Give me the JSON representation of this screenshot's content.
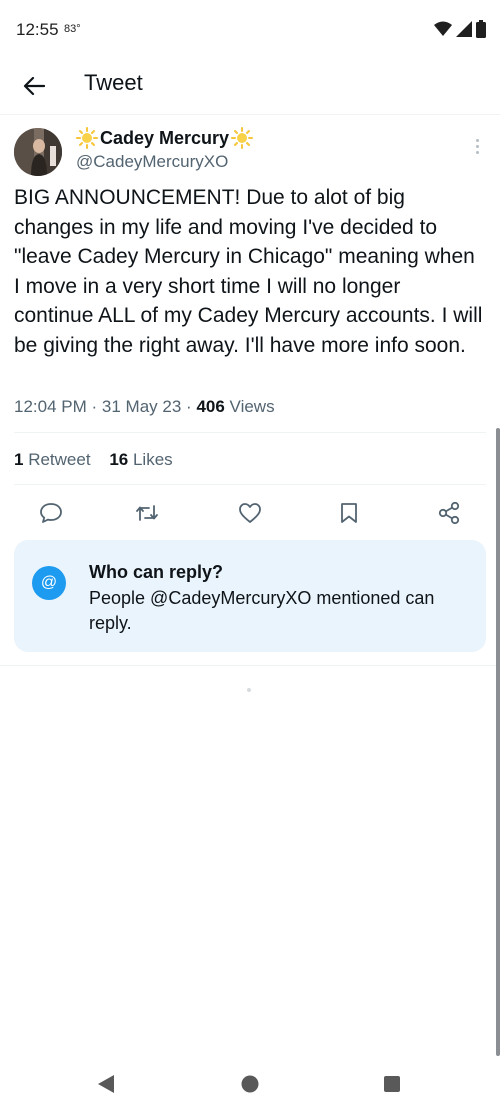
{
  "status_bar": {
    "time": "12:55",
    "temperature": "83°",
    "icons": [
      "wifi-icon",
      "signal-icon",
      "battery-icon"
    ]
  },
  "header": {
    "back_icon": "back-arrow-icon",
    "title": "Tweet"
  },
  "tweet": {
    "author": {
      "display_name": "Cadey Mercury",
      "name_decoration": "sun-emoji",
      "handle": "@CadeyMercuryXO"
    },
    "text": "BIG ANNOUNCEMENT! Due to alot of big changes in my life and moving I've decided to \"leave Cadey Mercury in Chicago\" meaning when I move in a very short time I will no longer continue ALL of my Cadey Mercury accounts. I will be giving the right away. I'll have more info soon.",
    "time": "12:04 PM",
    "separator": "·",
    "date": "31 May 23",
    "views_count": "406",
    "views_label": "Views",
    "retweets_count": "1",
    "retweets_label": "Retweet",
    "likes_count": "16",
    "likes_label": "Likes"
  },
  "actions": [
    "reply-icon",
    "retweet-icon",
    "like-icon",
    "bookmark-icon",
    "share-icon"
  ],
  "reply_restriction": {
    "icon": "@",
    "title": "Who can reply?",
    "description": "People @CadeyMercuryXO mentioned can reply."
  },
  "colors": {
    "accent": "#1d9bf0",
    "text": "#0f1419",
    "secondary_text": "#536471",
    "reply_card_bg": "#eaf4fc",
    "divider": "#eff3f4"
  },
  "nav_bar": [
    "back-triangle-icon",
    "home-circle-icon",
    "recents-square-icon"
  ]
}
